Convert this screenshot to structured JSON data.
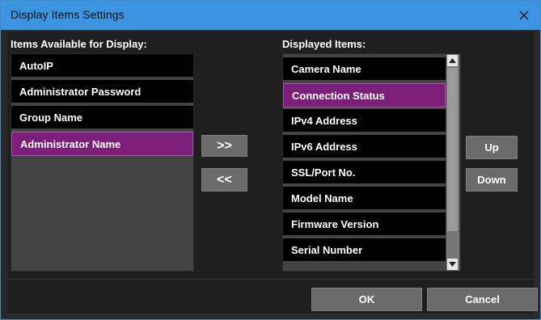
{
  "window": {
    "title": "Display Items Settings"
  },
  "available": {
    "label": "Items Available for Display:",
    "items": [
      "AutoIP",
      "Administrator Password",
      "Group Name",
      "Administrator Name"
    ]
  },
  "displayed": {
    "label": "Displayed Items:",
    "items": [
      "Camera Name",
      "Connection Status",
      "IPv4 Address",
      "IPv6 Address",
      "SSL/Port No.",
      "Model Name",
      "Firmware Version",
      "Serial Number"
    ]
  },
  "buttons": {
    "add": ">>",
    "remove": "<<",
    "up": "Up",
    "down": "Down",
    "ok": "OK",
    "cancel": "Cancel"
  },
  "colors": {
    "titlebar": "#3b95e0",
    "selection": "#7d1f7a",
    "button": "#6b6b6b"
  }
}
